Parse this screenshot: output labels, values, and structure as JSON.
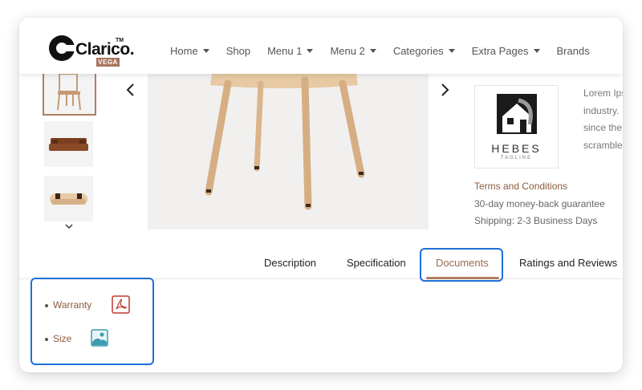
{
  "logo": {
    "text": "Clarico.",
    "tm": "TM",
    "badge": "VEGA"
  },
  "nav": {
    "items": [
      {
        "label": "Home",
        "dropdown": true
      },
      {
        "label": "Shop",
        "dropdown": false
      },
      {
        "label": "Menu 1",
        "dropdown": true
      },
      {
        "label": "Menu 2",
        "dropdown": true
      },
      {
        "label": "Categories",
        "dropdown": true
      },
      {
        "label": "Extra Pages",
        "dropdown": true
      },
      {
        "label": "Brands",
        "dropdown": false
      }
    ]
  },
  "brand": {
    "name": "HEBES",
    "tagline": "TAGLINE"
  },
  "description": {
    "lines": [
      "Lorem Ips",
      "industry.",
      "since the",
      "scramble"
    ]
  },
  "info": {
    "terms": "Terms and Conditions",
    "guarantee": "30-day money-back guarantee",
    "shipping": "Shipping: 2-3 Business Days"
  },
  "tabs": {
    "items": [
      "Description",
      "Specification",
      "Documents",
      "Ratings and Reviews"
    ],
    "active": "Documents"
  },
  "documents": [
    {
      "label": "Warranty",
      "icon": "pdf-icon"
    },
    {
      "label": "Size",
      "icon": "image-icon"
    }
  ],
  "colors": {
    "accent": "#b07e62",
    "highlight": "#1e6fd9",
    "link": "#8a5a3c"
  }
}
